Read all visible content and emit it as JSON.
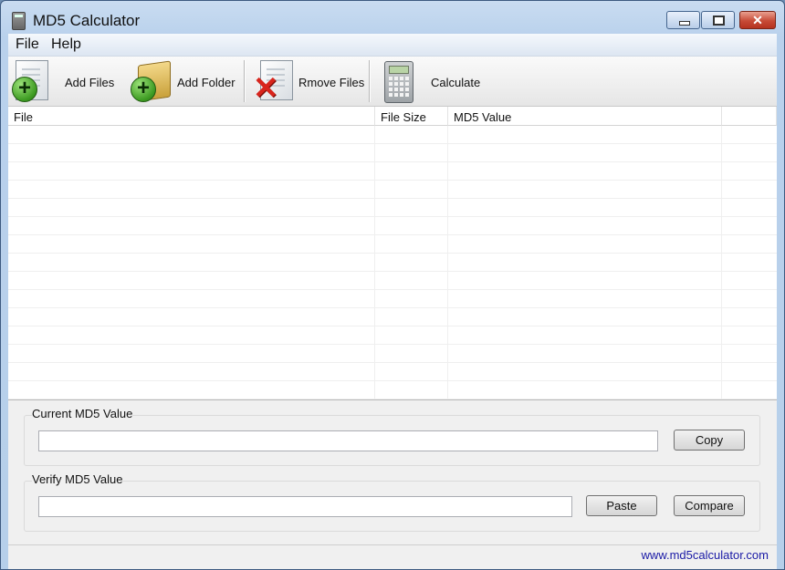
{
  "window": {
    "title": "MD5 Calculator"
  },
  "menu": {
    "file": "File",
    "help": "Help"
  },
  "toolbar": {
    "add_files": "Add Files",
    "add_folder": "Add Folder",
    "remove_files": "Rmove Files",
    "calculate": "Calculate"
  },
  "table": {
    "columns": [
      "File",
      "File Size",
      "MD5 Value",
      ""
    ]
  },
  "current": {
    "label": "Current MD5 Value",
    "value": "",
    "copy": "Copy"
  },
  "verify": {
    "label": "Verify MD5 Value",
    "value": "",
    "paste": "Paste",
    "compare": "Compare"
  },
  "status": {
    "website": "www.md5calculator.com"
  }
}
